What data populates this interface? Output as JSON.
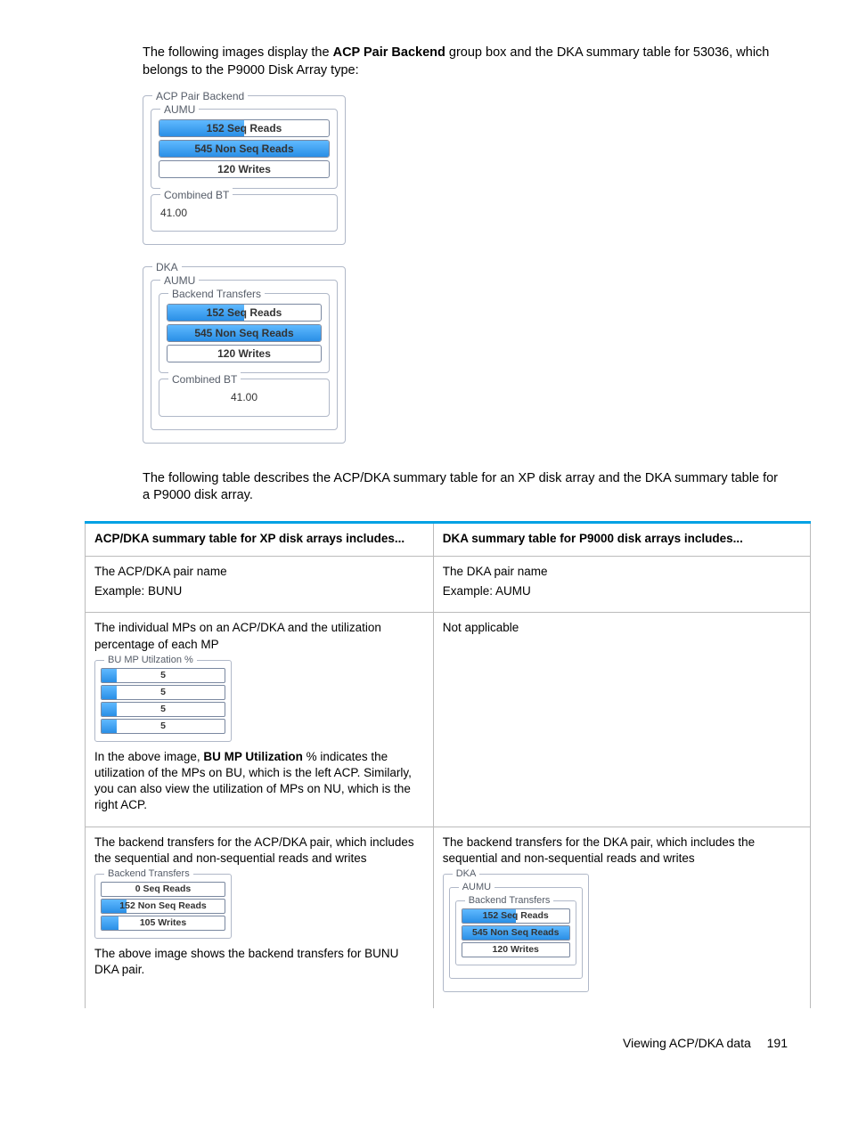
{
  "intro_part1": "The following images display the ",
  "intro_bold": "ACP Pair Backend",
  "intro_part2": " group box and the DKA summary table for 53036, which belongs to the P9000 Disk Array type:",
  "panel1": {
    "title": "ACP Pair Backend",
    "aumu_title": "AUMU",
    "seq": "152 Seq Reads",
    "nonseq": "545 Non Seq Reads",
    "writes": "120 Writes",
    "combined_title": "Combined BT",
    "combined_val": "41.00"
  },
  "panel2": {
    "title": "DKA",
    "aumu_title": "AUMU",
    "bt_title": "Backend Transfers",
    "seq": "152 Seq Reads",
    "nonseq": "545 Non Seq Reads",
    "writes": "120 Writes",
    "combined_title": "Combined BT",
    "combined_val": "41.00"
  },
  "intro2": "The following table describes the ACP/DKA summary table for an XP disk array and the DKA summary table for a P9000 disk array.",
  "table": {
    "h1": "ACP/DKA summary table for XP disk arrays includes...",
    "h2": "DKA summary table for P9000 disk arrays includes...",
    "r1c1a": "The ACP/DKA pair name",
    "r1c1b": "Example: BUNU",
    "r1c2a": "The DKA pair name",
    "r1c2b": "Example: AUMU",
    "r2c1a": "The individual MPs on an ACP/DKA and the utilization percentage of each MP",
    "r2c1_box_title": "BU MP Utilzation %",
    "r2c1_vals": [
      "5",
      "5",
      "5",
      "5"
    ],
    "r2c1b_pre": "In the above image, ",
    "r2c1b_bold": "BU MP Utilization",
    "r2c1b_post": " % indicates the utilization of the MPs on BU, which is the left ACP. Similarly, you can also view the utilization of MPs on NU, which is the right ACP.",
    "r2c2": "Not applicable",
    "r3c1a": "The backend transfers for the ACP/DKA pair, which includes the sequential and non-sequential reads and writes",
    "r3c1_box_title": "Backend Transfers",
    "r3c1_seq": "0 Seq Reads",
    "r3c1_nonseq": "152 Non Seq Reads",
    "r3c1_writes": "105 Writes",
    "r3c1b": "The above image shows the backend transfers for BUNU DKA pair.",
    "r3c2a": "The backend transfers for the DKA pair, which includes the sequential and non-sequential reads and writes",
    "r3c2_dka": "DKA",
    "r3c2_aumu": "AUMU",
    "r3c2_bt": "Backend Transfers",
    "r3c2_seq": "152 Seq Reads",
    "r3c2_nonseq": "545 Non Seq Reads",
    "r3c2_writes": "120 Writes"
  },
  "footer_text": "Viewing ACP/DKA data",
  "footer_page": "191"
}
